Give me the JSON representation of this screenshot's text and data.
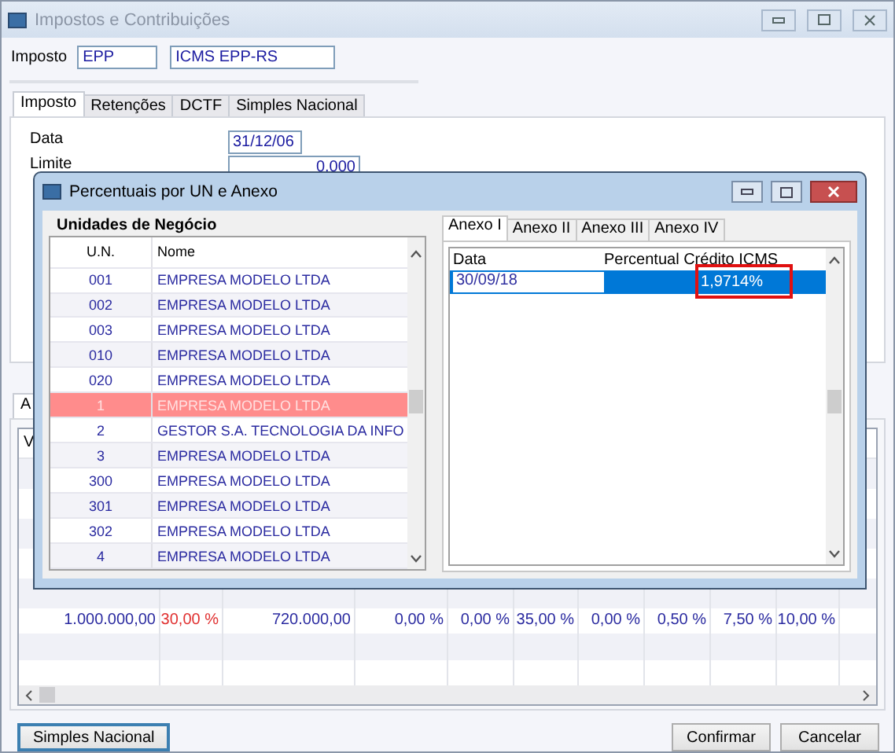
{
  "window": {
    "title": "Impostos e Contribuições"
  },
  "imposto": {
    "label": "Imposto",
    "code": "EPP",
    "description": "ICMS EPP-RS"
  },
  "tabs": [
    {
      "label": "Imposto",
      "selected": true
    },
    {
      "label": "Retenções",
      "selected": false
    },
    {
      "label": "DCTF",
      "selected": false
    },
    {
      "label": "Simples Nacional",
      "selected": false
    }
  ],
  "fields": [
    {
      "label": "Data",
      "value": "31/12/06"
    },
    {
      "label": "Limite",
      "value": "0,000"
    }
  ],
  "lower_panel": {
    "tab": "A",
    "column_1": "V",
    "rows": [
      [
        "1.000.000,00",
        "30,00 %",
        "720.000,00",
        "0,00 %",
        "0,00 %",
        "35,00 %",
        "0,00 %",
        "0,50 %",
        "7,50 %",
        "10,00 %"
      ]
    ]
  },
  "dialog": {
    "title": "Percentuais por UN e Anexo",
    "group_title": "Unidades de Negócio",
    "columns": [
      "U.N.",
      "Nome"
    ],
    "rows": [
      {
        "un": "001",
        "nome": "EMPRESA MODELO LTDA",
        "selected": false
      },
      {
        "un": "002",
        "nome": "EMPRESA MODELO LTDA",
        "selected": false
      },
      {
        "un": "003",
        "nome": "EMPRESA MODELO LTDA",
        "selected": false
      },
      {
        "un": "010",
        "nome": "EMPRESA MODELO LTDA",
        "selected": false
      },
      {
        "un": "020",
        "nome": "EMPRESA MODELO LTDA",
        "selected": false
      },
      {
        "un": "1",
        "nome": "EMPRESA MODELO LTDA",
        "selected": true
      },
      {
        "un": "2",
        "nome": "GESTOR S.A. TECNOLOGIA DA INFO",
        "selected": false
      },
      {
        "un": "3",
        "nome": "EMPRESA MODELO LTDA",
        "selected": false
      },
      {
        "un": "300",
        "nome": "EMPRESA MODELO LTDA",
        "selected": false
      },
      {
        "un": "301",
        "nome": "EMPRESA MODELO LTDA",
        "selected": false
      },
      {
        "un": "302",
        "nome": "EMPRESA MODELO LTDA",
        "selected": false
      },
      {
        "un": "4",
        "nome": "EMPRESA MODELO LTDA",
        "selected": false
      }
    ],
    "anexo_tabs": [
      {
        "label": "Anexo I",
        "selected": true
      },
      {
        "label": "Anexo II",
        "selected": false
      },
      {
        "label": "Anexo III",
        "selected": false
      },
      {
        "label": "Anexo IV",
        "selected": false
      }
    ],
    "anexo_columns": [
      "Data",
      "Percentual Crédito ICMS"
    ],
    "anexo_rows": [
      {
        "data": "30/09/18",
        "percentual": "1,9714%",
        "selected": true,
        "highlighted": true
      }
    ]
  },
  "buttons_left": [
    {
      "label": "Simples Nacional",
      "focused": true
    }
  ],
  "buttons_right": [
    {
      "label": "Confirmar",
      "focused": false
    },
    {
      "label": "Cancelar",
      "focused": false
    }
  ]
}
